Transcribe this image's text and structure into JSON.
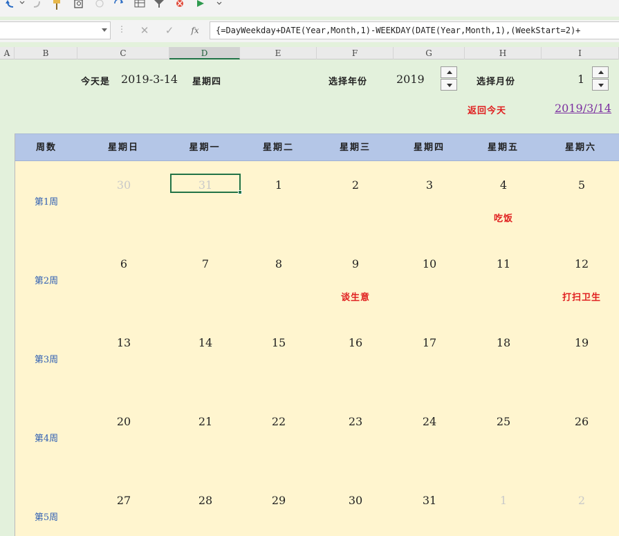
{
  "toolbar": {
    "icons": [
      "undo-icon",
      "redo-icon",
      "format-painter-icon",
      "print-preview-icon",
      "circle-icon",
      "refresh-icon",
      "table-icon",
      "filter-icon",
      "delete-icon",
      "play-icon",
      "more-icon"
    ]
  },
  "formula_bar": {
    "namebox_value": "",
    "cancel_symbol": "✕",
    "confirm_symbol": "✓",
    "fx_symbol": "fx",
    "formula": "{=DayWeekday+DATE(Year,Month,1)-WEEKDAY(DATE(Year,Month,1),(WeekStart=2)+"
  },
  "columns": [
    "A",
    "B",
    "C",
    "D",
    "E",
    "F",
    "G",
    "H",
    "I"
  ],
  "selected_column": "D",
  "info": {
    "today_prefix": "今天是",
    "today_date": "2019-3-14",
    "today_weekday": "星期四",
    "select_year_label": "选择年份",
    "year_value": "2019",
    "select_month_label": "选择月份",
    "month_value": "1",
    "return_today_label": "返回今天",
    "today_link": "2019/3/14"
  },
  "calendar": {
    "header": [
      "周数",
      "星期日",
      "星期一",
      "星期二",
      "星期三",
      "星期四",
      "星期五",
      "星期六"
    ],
    "weeks": [
      {
        "label": "第1周",
        "days": [
          "30",
          "31",
          "1",
          "2",
          "3",
          "4",
          "5"
        ],
        "other_month": [
          true,
          true,
          false,
          false,
          false,
          false,
          false
        ],
        "events": [
          "",
          "",
          "",
          "",
          "",
          "吃饭",
          ""
        ]
      },
      {
        "label": "第2周",
        "days": [
          "6",
          "7",
          "8",
          "9",
          "10",
          "11",
          "12"
        ],
        "other_month": [
          false,
          false,
          false,
          false,
          false,
          false,
          false
        ],
        "events": [
          "",
          "",
          "",
          "谈生意",
          "",
          "",
          "打扫卫生"
        ]
      },
      {
        "label": "第3周",
        "days": [
          "13",
          "14",
          "15",
          "16",
          "17",
          "18",
          "19"
        ],
        "other_month": [
          false,
          false,
          false,
          false,
          false,
          false,
          false
        ],
        "events": [
          "",
          "",
          "",
          "",
          "",
          "",
          ""
        ]
      },
      {
        "label": "第4周",
        "days": [
          "20",
          "21",
          "22",
          "23",
          "24",
          "25",
          "26"
        ],
        "other_month": [
          false,
          false,
          false,
          false,
          false,
          false,
          false
        ],
        "events": [
          "",
          "",
          "",
          "",
          "",
          "",
          ""
        ]
      },
      {
        "label": "第5周",
        "days": [
          "27",
          "28",
          "29",
          "30",
          "31",
          "1",
          "2"
        ],
        "other_month": [
          false,
          false,
          false,
          false,
          false,
          true,
          true
        ],
        "events": [
          "",
          "",
          "",
          "",
          "",
          "",
          ""
        ]
      }
    ]
  },
  "colors": {
    "accent": "#217346",
    "event": "#e02020",
    "week_label": "#2f5fb3",
    "header_bg": "#b4c6e7",
    "calendar_bg": "#fff5cf",
    "sheet_bg": "#e3f1dc",
    "link": "#7b2fa0"
  }
}
